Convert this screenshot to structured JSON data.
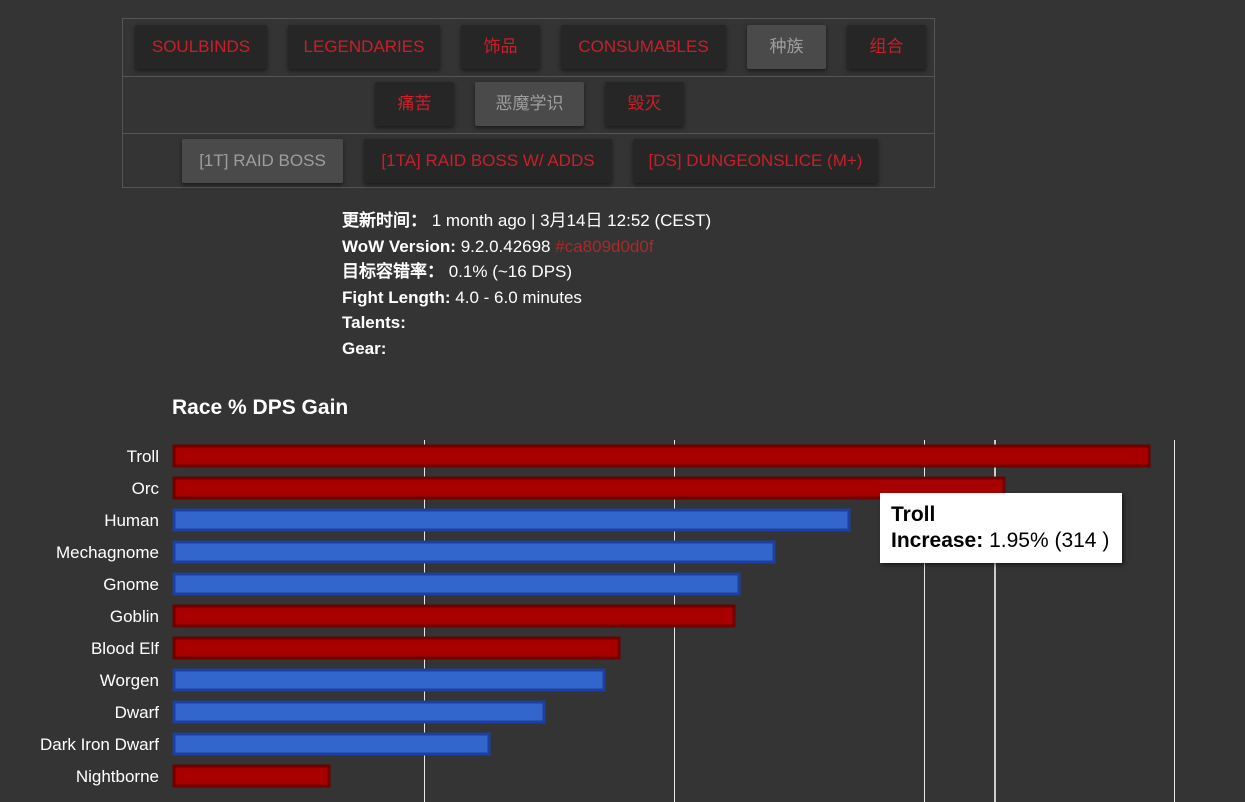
{
  "nav": {
    "row1": [
      {
        "label": "SOULBINDS",
        "active": false
      },
      {
        "label": "LEGENDARIES",
        "active": false
      },
      {
        "label": "饰品",
        "active": false
      },
      {
        "label": "CONSUMABLES",
        "active": false
      },
      {
        "label": "种族",
        "active": true
      },
      {
        "label": "组合",
        "active": false
      }
    ],
    "row2": [
      {
        "label": "痛苦",
        "active": false
      },
      {
        "label": "恶魔学识",
        "active": true
      },
      {
        "label": "毁灭",
        "active": false
      }
    ],
    "row3": [
      {
        "label": "[1T] RAID BOSS",
        "active": true
      },
      {
        "label": "[1TA] RAID BOSS W/ ADDS",
        "active": false
      },
      {
        "label": "[DS] DUNGEONSLICE (M+)",
        "active": false
      }
    ]
  },
  "meta": {
    "updated_key": "更新时间：",
    "updated_val": " 1 month ago | 3月14日 12:52 (CEST)",
    "version_key": "WoW Version:",
    "version_val": " 9.2.0.42698 ",
    "version_hash": "#ca809d0d0f",
    "tolerance_key": "目标容错率：",
    "tolerance_val": " 0.1% (~16 DPS)",
    "fight_key": "Fight Length:",
    "fight_val": " 4.0 - 6.0 minutes",
    "talents_key": "Talents:",
    "gear_key": "Gear:"
  },
  "tooltip": {
    "title": "Troll",
    "key": "Increase:",
    "value": " 1.95% (314 )"
  },
  "chart_data": {
    "type": "bar",
    "orientation": "horizontal",
    "title": "Race % DPS Gain",
    "categories": [
      "Troll",
      "Orc",
      "Human",
      "Mechagnome",
      "Gnome",
      "Goblin",
      "Blood Elf",
      "Worgen",
      "Dwarf",
      "Dark Iron Dwarf",
      "Nightborne"
    ],
    "values": [
      1.95,
      1.66,
      1.35,
      1.2,
      1.13,
      1.12,
      0.89,
      0.86,
      0.74,
      0.63,
      0.31
    ],
    "faction": [
      "horde",
      "horde",
      "alliance",
      "alliance",
      "alliance",
      "horde",
      "horde",
      "alliance",
      "alliance",
      "alliance",
      "horde"
    ],
    "xlim": [
      0,
      2.0
    ],
    "x_gridlines": [
      0.5,
      1.0,
      1.5,
      2.0
    ],
    "grid": true,
    "colors": {
      "horde": "#a80000",
      "horde_border": "#6e0000",
      "alliance": "#3366cc",
      "alliance_border": "#1d3fa0"
    }
  }
}
